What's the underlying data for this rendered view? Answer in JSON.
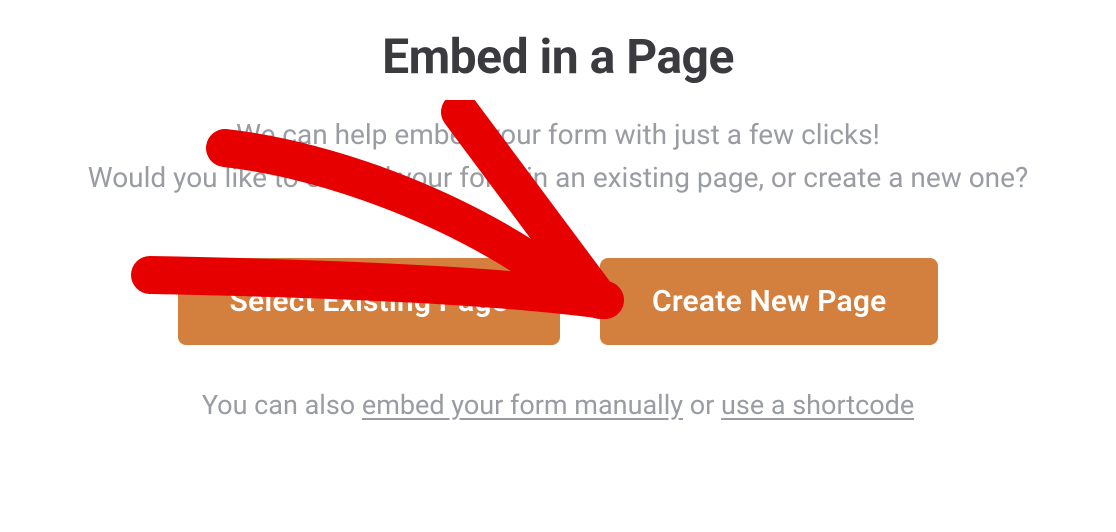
{
  "title": "Embed in a Page",
  "description_line1": "We can help embed your form with just a few clicks!",
  "description_line2": "Would you like to embed your form in an existing page, or create a new one?",
  "buttons": {
    "select_existing": "Select Existing Page",
    "create_new": "Create New Page"
  },
  "footer": {
    "prefix": "You can also ",
    "link_manual": "embed your form manually",
    "middle": " or ",
    "link_shortcode": "use a shortcode"
  },
  "colors": {
    "button_bg": "#d37f3d",
    "title_color": "#3b3b3f",
    "muted_text": "#9a9ca3",
    "annotation": "#e60000"
  }
}
